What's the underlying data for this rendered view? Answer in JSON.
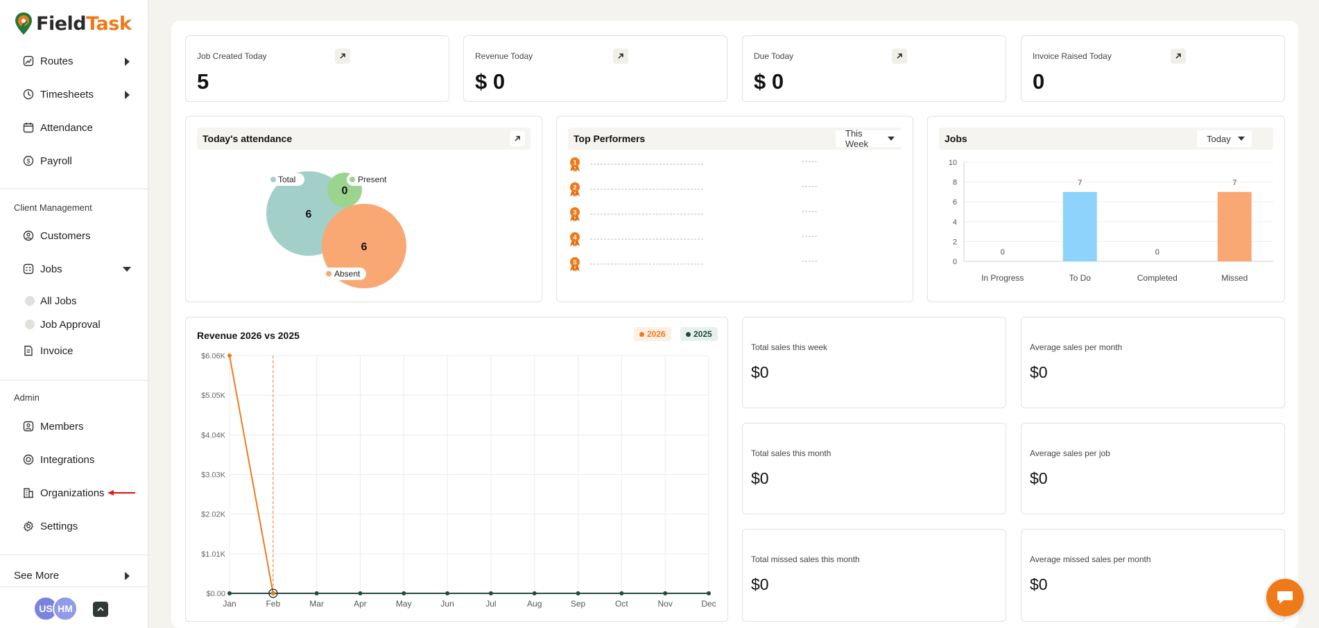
{
  "brand": {
    "name_part1": "Field",
    "name_part2": "Task",
    "accent": "#ef7a1a"
  },
  "sidebar": {
    "top_items": [
      {
        "label": "Routes",
        "icon": "routes-icon"
      },
      {
        "label": "Timesheets",
        "icon": "clock-icon"
      },
      {
        "label": "Attendance",
        "icon": "calendar-icon"
      },
      {
        "label": "Payroll",
        "icon": "payroll-icon"
      }
    ],
    "client_section": "Client Management",
    "client_items": [
      {
        "label": "Customers",
        "icon": "customers-icon"
      },
      {
        "label": "Jobs",
        "icon": "jobs-icon"
      }
    ],
    "job_subitems": [
      {
        "label": "All Jobs"
      },
      {
        "label": "Job Approval"
      }
    ],
    "invoice": {
      "label": "Invoice",
      "icon": "invoice-icon"
    },
    "admin_section": "Admin",
    "admin_items": [
      {
        "label": "Members",
        "icon": "members-icon"
      },
      {
        "label": "Integrations",
        "icon": "integrations-icon"
      },
      {
        "label": "Organizations",
        "icon": "organizations-icon"
      },
      {
        "label": "Settings",
        "icon": "settings-icon"
      }
    ],
    "see_more": "See More",
    "avatars": [
      {
        "initials": "US",
        "color": "#7b83e0"
      },
      {
        "initials": "HM",
        "color": "#8f9aeb"
      }
    ]
  },
  "stats": [
    {
      "label": "Job Created Today",
      "value": "5"
    },
    {
      "label": "Revenue Today",
      "value": "$ 0"
    },
    {
      "label": "Due Today",
      "value": "$ 0"
    },
    {
      "label": "Invoice Raised Today",
      "value": "0"
    }
  ],
  "attendance": {
    "title": "Today's attendance",
    "total_label": "Total",
    "total_value": "6",
    "present_label": "Present",
    "present_value": "0",
    "absent_label": "Absent",
    "absent_value": "6",
    "colors": {
      "total": "#a3cfc9",
      "present": "#9bd48f",
      "absent": "#f9a874"
    }
  },
  "top_performers": {
    "title": "Top Performers",
    "filter": "This Week",
    "ranks": [
      "1",
      "2",
      "3",
      "4",
      "5"
    ],
    "placeholder_value": "-----"
  },
  "jobs_panel": {
    "title": "Jobs",
    "filter": "Today",
    "chart_data": {
      "type": "bar",
      "categories": [
        "In Progress",
        "To Do",
        "Completed",
        "Missed"
      ],
      "values": [
        0,
        7,
        0,
        7
      ],
      "colors": [
        "#8ed3fb",
        "#8ed3fb",
        "#8ed3fb",
        "#f9a874"
      ],
      "ylim": [
        0,
        10
      ],
      "yticks": [
        0,
        2,
        4,
        6,
        8,
        10
      ]
    }
  },
  "revenue": {
    "title": "Revenue 2026 vs 2025",
    "chart_data": {
      "type": "line",
      "categories": [
        "Jan",
        "Feb",
        "Mar",
        "Apr",
        "May",
        "Jun",
        "Jul",
        "Aug",
        "Sep",
        "Oct",
        "Nov",
        "Dec"
      ],
      "series": [
        {
          "name": "2026",
          "color": "#ef7a1a",
          "values": [
            6060,
            0,
            null,
            null,
            null,
            null,
            null,
            null,
            null,
            null,
            null,
            null
          ]
        },
        {
          "name": "2025",
          "color": "#1f4a40",
          "values": [
            0,
            0,
            0,
            0,
            0,
            0,
            0,
            0,
            0,
            0,
            0,
            0
          ]
        }
      ],
      "yticks": [
        0,
        1010,
        2020,
        3030,
        4040,
        5050,
        6060
      ],
      "ytick_labels": [
        "$0.00",
        "$1.01K",
        "$2.02K",
        "$3.03K",
        "$4.04K",
        "$5.05K",
        "$6.06K"
      ],
      "ylim": [
        0,
        6060
      ],
      "marker_month": "Feb"
    }
  },
  "sales": [
    {
      "label": "Total sales this week",
      "value": "$0"
    },
    {
      "label": "Average sales per month",
      "value": "$0"
    },
    {
      "label": "Total sales this month",
      "value": "$0"
    },
    {
      "label": "Average sales per job",
      "value": "$0"
    },
    {
      "label": "Total missed sales this month",
      "value": "$0"
    },
    {
      "label": "Average missed sales per month",
      "value": "$0"
    }
  ]
}
